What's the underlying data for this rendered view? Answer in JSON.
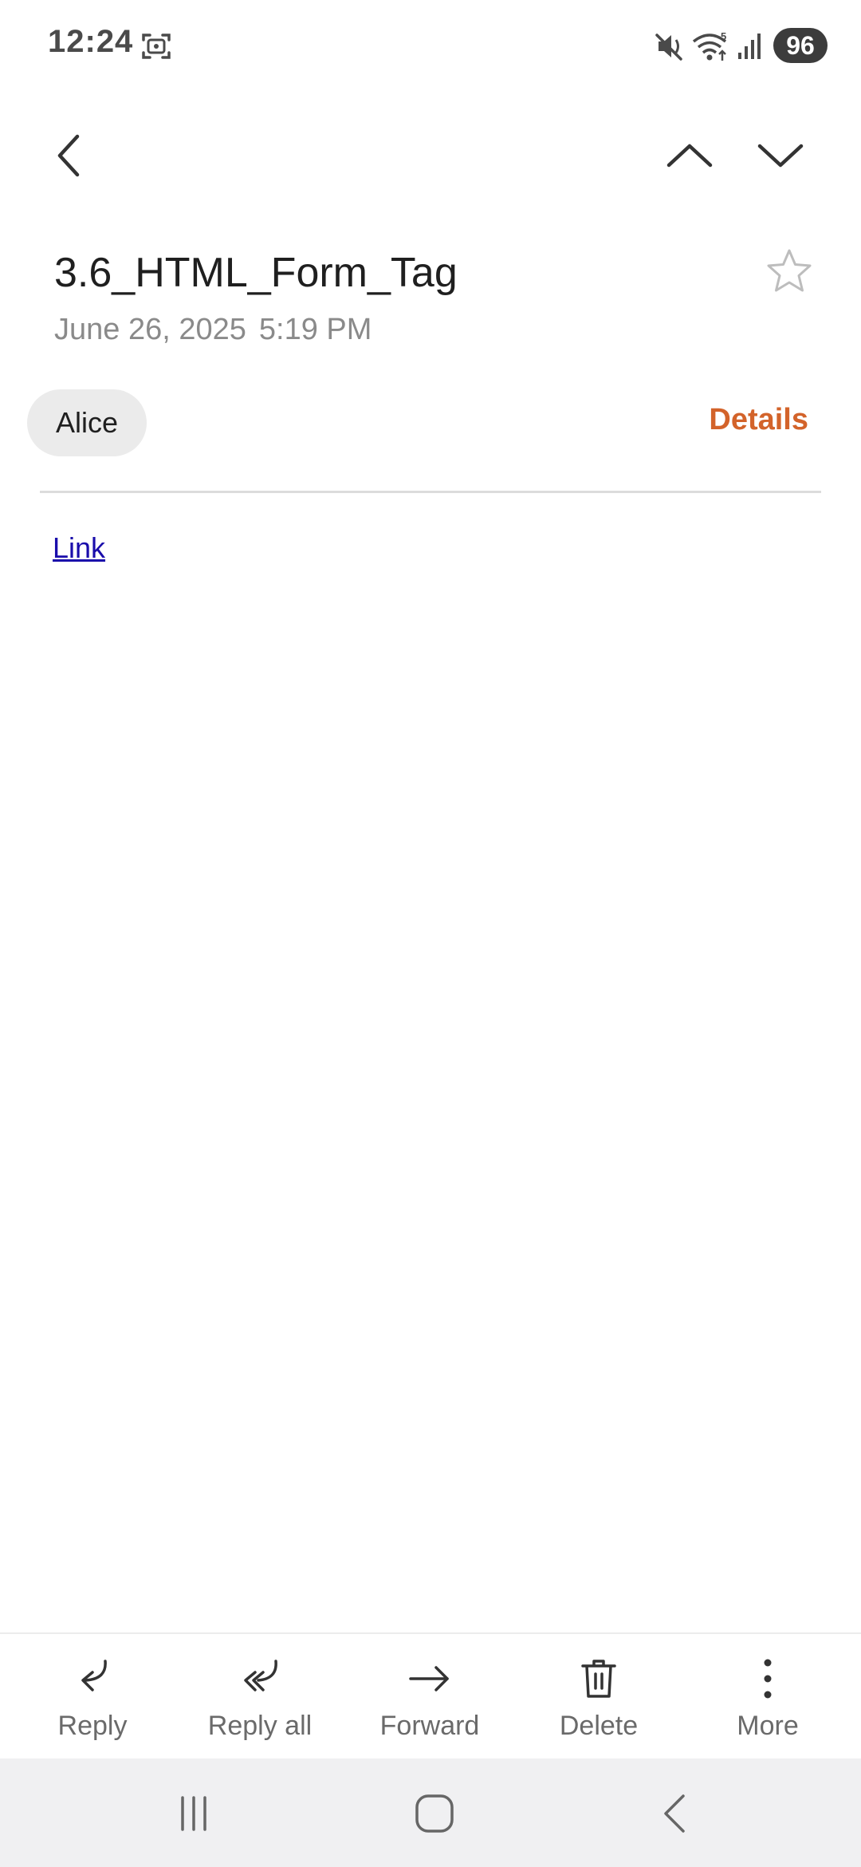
{
  "status_bar": {
    "time": "12:24",
    "battery": "96",
    "icons": [
      "screenshot-icon",
      "mute-icon",
      "wifi-icon",
      "signal-icon"
    ]
  },
  "toolbar": {
    "icons": [
      "back-arrow-icon",
      "chevron-up-icon",
      "chevron-down-icon"
    ]
  },
  "email": {
    "subject": "3.6_HTML_Form_Tag",
    "date": "June 26, 2025",
    "time": "5:19 PM",
    "sender": "Alice",
    "details_label": "Details",
    "body_link": "Link"
  },
  "actions": {
    "reply": "Reply",
    "reply_all": "Reply all",
    "forward": "Forward",
    "delete": "Delete",
    "more": "More"
  },
  "colors": {
    "accent": "#d3632a",
    "link": "#1a0dab",
    "chip_bg": "#ebebeb",
    "nav_bg": "#f0f0f2"
  }
}
